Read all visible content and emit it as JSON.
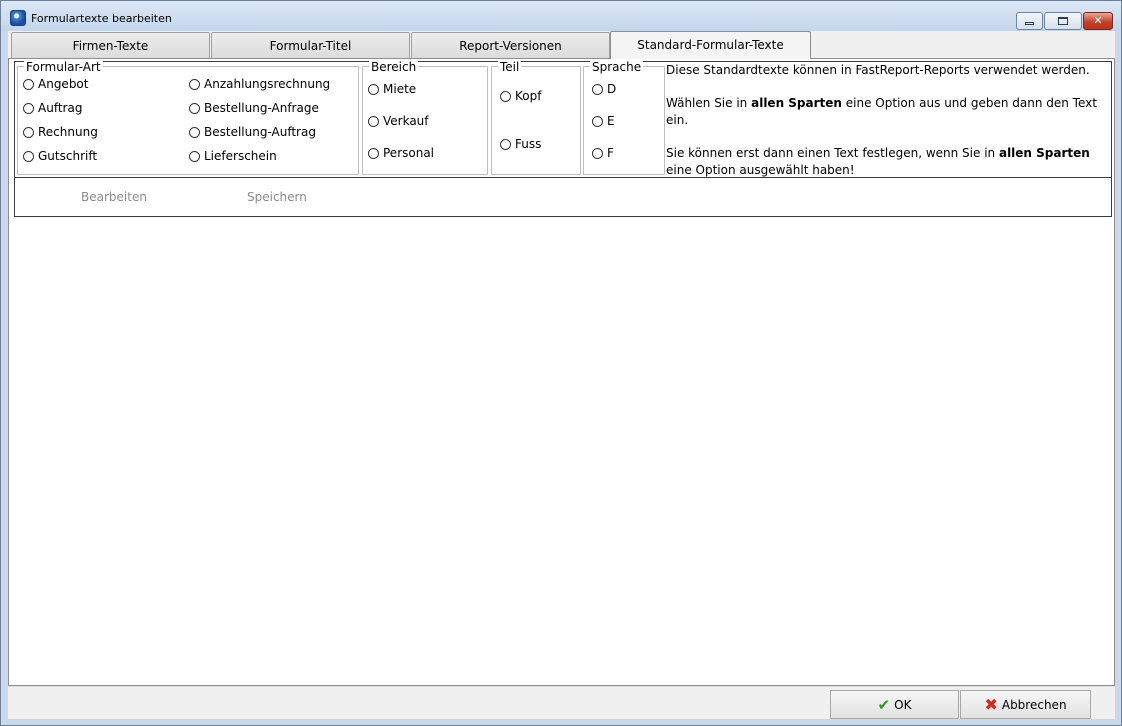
{
  "window": {
    "title": "Formulartexte bearbeiten"
  },
  "title_buttons": {
    "minimize": "",
    "maximize": "",
    "close": "✕"
  },
  "tabs": [
    {
      "label": "Firmen-Texte"
    },
    {
      "label": "Formular-Titel"
    },
    {
      "label": "Report-Versionen"
    },
    {
      "label": "Standard-Formular-Texte",
      "active": true
    }
  ],
  "formular_art": {
    "label": "Formular-Art",
    "options": [
      "Angebot",
      "Auftrag",
      "Rechnung",
      "Gutschrift",
      "Anzahlungsrechnung",
      "Bestellung-Anfrage",
      "Bestellung-Auftrag",
      "Lieferschein"
    ]
  },
  "bereich": {
    "label": "Bereich",
    "options": [
      "Miete",
      "Verkauf",
      "Personal"
    ]
  },
  "teil": {
    "label": "Teil",
    "options": [
      "Kopf",
      "Fuss"
    ]
  },
  "sprache": {
    "label": "Sprache",
    "options": [
      "D",
      "E",
      "F"
    ]
  },
  "info": {
    "line1": "Diese Standardtexte können in FastReport-Reports verwendet werden.",
    "line2_pre": "Wählen Sie in ",
    "line2_bold": "allen Sparten",
    "line2_post": " eine Option aus und geben dann den Text ein.",
    "line3_pre": "Sie können erst dann einen Text festlegen, wenn Sie in ",
    "line3_bold": "allen Sparten",
    "line3_post": " eine Option ausgewählt haben!"
  },
  "actions": {
    "edit": "Bearbeiten",
    "save": "Speichern"
  },
  "dialog": {
    "ok": "OK",
    "cancel": "Abbrechen"
  },
  "colors": {
    "ok_icon": "#2f9a1e",
    "cancel_icon": "#d6281b",
    "disabled_text": "#8c8c8c"
  }
}
